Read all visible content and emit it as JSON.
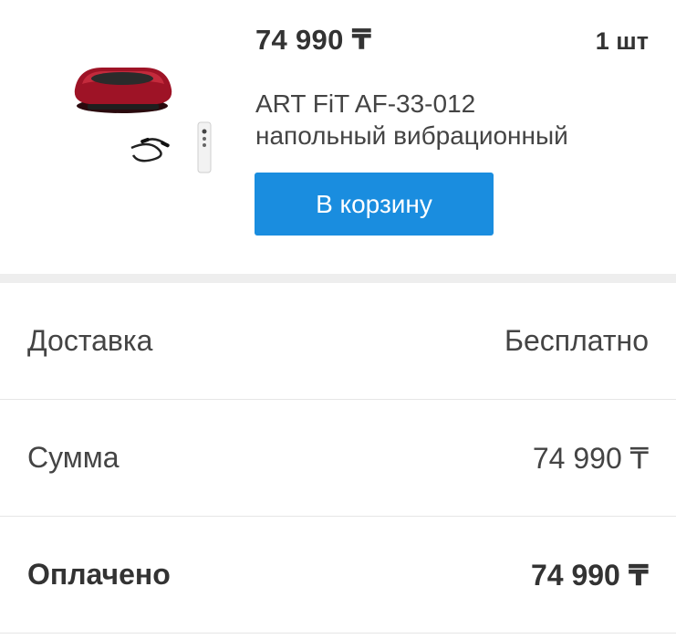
{
  "product": {
    "price": "74 990 ₸",
    "quantity": "1 шт",
    "title_line1": "ART FiT AF-33-012",
    "title_line2": "напольный вибрационный",
    "cart_button_label": "В корзину",
    "image_icon": "vibration-platform-image"
  },
  "summary": {
    "delivery_label": "Доставка",
    "delivery_value": "Бесплатно",
    "sum_label": "Сумма",
    "sum_value": "74 990 ₸",
    "paid_label": "Оплачено",
    "paid_value": "74 990 ₸"
  },
  "colors": {
    "button": "#1a8ddf",
    "separator": "#eeeeee",
    "product_red": "#9e1326"
  }
}
